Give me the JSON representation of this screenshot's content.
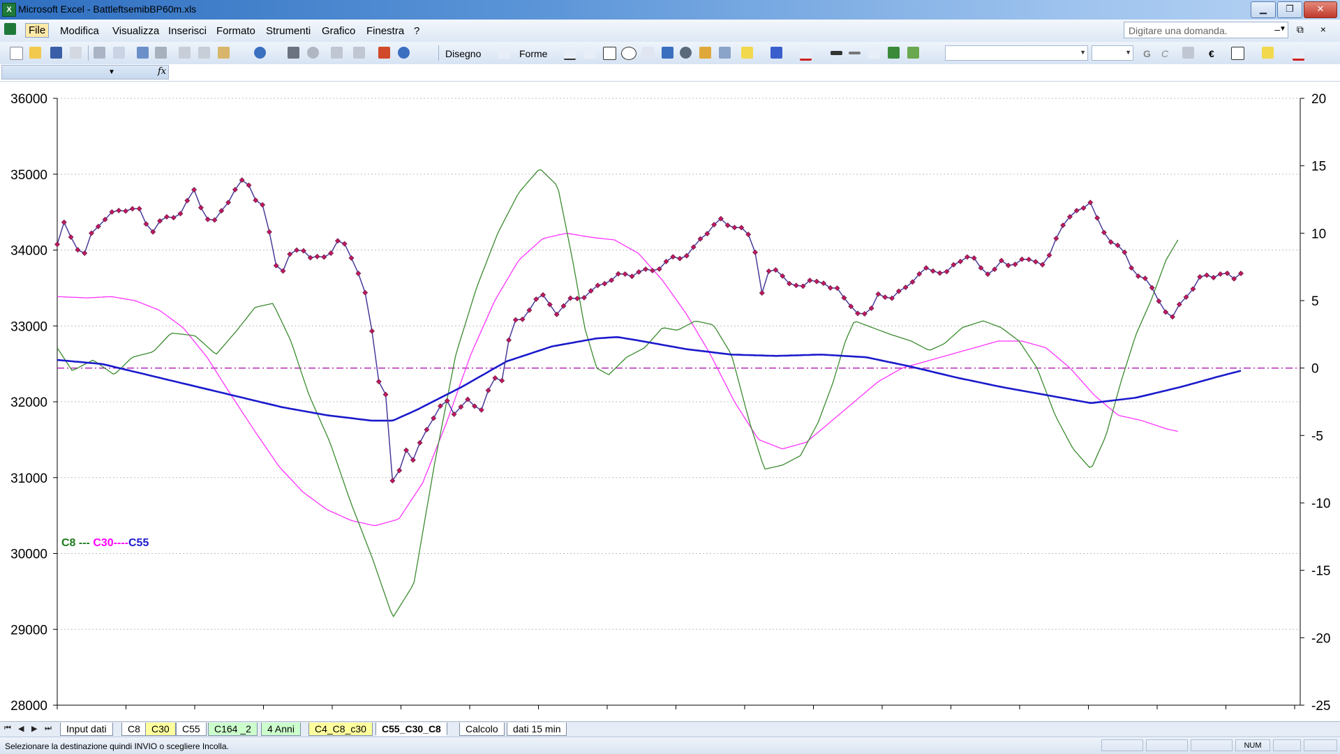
{
  "window": {
    "title": "Microsoft Excel - BattleftsemibBP60m.xls",
    "minimize": "▁",
    "restore": "❐",
    "close": "✕"
  },
  "menu": {
    "items": [
      "File",
      "Modifica",
      "Visualizza",
      "Inserisci",
      "Formato",
      "Strumenti",
      "Grafico",
      "Finestra",
      "?"
    ],
    "ask_placeholder": "Digitare una domanda.",
    "mdi": "–  ⧉  ×"
  },
  "toolbar": {
    "drawing_label": "Disegno",
    "shapes_label": "Forme",
    "bold": "G",
    "italic": "C",
    "euro": "€"
  },
  "formula": {
    "fx": "fx"
  },
  "chart_data": {
    "type": "line",
    "legend_text": {
      "c8": "C8 ---",
      "c30": " C30----",
      "c55": "C55"
    },
    "colors": {
      "price": "#4a3a9a",
      "price_marker": "#c2185b",
      "c8": "#3a8a2e",
      "c30": "#ff33ff",
      "c55": "#1a1acc",
      "zero": "#b01ab0",
      "legend_c8": "#1a7a1a",
      "legend_c30": "#ff00ff",
      "legend_c55": "#1a1acc"
    },
    "left_axis": {
      "min": 28000,
      "max": 36000,
      "ticks": [
        "28000",
        "29000",
        "30000",
        "31000",
        "32000",
        "33000",
        "34000",
        "35000",
        "36000"
      ]
    },
    "right_axis": {
      "min": -25,
      "max": 20,
      "ticks": [
        "-25",
        "-20",
        "-15",
        "-10",
        "-5",
        "0",
        "5",
        "10",
        "15",
        "20"
      ]
    },
    "n_points": 174,
    "zero_line": 0,
    "price": {
      "anchors": [
        [
          0,
          34050
        ],
        [
          1,
          34380
        ],
        [
          3,
          34280
        ],
        [
          6,
          34100
        ],
        [
          9,
          33950
        ],
        [
          12,
          34260
        ],
        [
          16,
          34400
        ],
        [
          20,
          34500
        ],
        [
          24,
          34600
        ],
        [
          28,
          34500
        ],
        [
          31,
          34200
        ],
        [
          34,
          34350
        ],
        [
          38,
          34450
        ],
        [
          42,
          34550
        ],
        [
          46,
          34780
        ],
        [
          49,
          34450
        ],
        [
          52,
          34330
        ],
        [
          56,
          34630
        ],
        [
          59,
          34780
        ],
        [
          63,
          34920
        ],
        [
          66,
          34680
        ],
        [
          69,
          34560
        ],
        [
          71,
          34200
        ],
        [
          73,
          33850
        ],
        [
          75,
          33720
        ],
        [
          78,
          33920
        ],
        [
          82,
          34020
        ],
        [
          85,
          33880
        ],
        [
          88,
          33920
        ],
        [
          91,
          33980
        ],
        [
          94,
          34100
        ],
        [
          97,
          33990
        ],
        [
          100,
          33780
        ],
        [
          102,
          33520
        ],
        [
          104,
          33280
        ],
        [
          105,
          32950
        ],
        [
          107,
          32350
        ],
        [
          108,
          32200
        ],
        [
          110,
          32050
        ],
        [
          111,
          30820
        ],
        [
          113,
          31000
        ],
        [
          115,
          31150
        ],
        [
          117,
          31500
        ],
        [
          119,
          31200
        ],
        [
          121,
          31450
        ],
        [
          124,
          31720
        ],
        [
          127,
          31850
        ],
        [
          130,
          31990
        ],
        [
          133,
          31850
        ],
        [
          136,
          32050
        ],
        [
          139,
          31950
        ],
        [
          142,
          31900
        ],
        [
          145,
          32250
        ],
        [
          148,
          32300
        ],
        [
          150,
          32330
        ],
        [
          151,
          33100
        ],
        [
          155,
          33050
        ],
        [
          158,
          33250
        ],
        [
          161,
          33400
        ],
        [
          164,
          33300
        ],
        [
          167,
          33200
        ],
        [
          170,
          33320
        ],
        [
          173,
          33350
        ],
        [
          176,
          33380
        ],
        [
          179,
          33450
        ],
        [
          182,
          33600
        ],
        [
          185,
          33640
        ],
        [
          188,
          33660
        ],
        [
          191,
          33650
        ],
        [
          194,
          33700
        ],
        [
          197,
          33730
        ],
        [
          200,
          33790
        ],
        [
          203,
          33830
        ],
        [
          206,
          33870
        ],
        [
          209,
          33900
        ],
        [
          212,
          34000
        ],
        [
          215,
          34180
        ],
        [
          218,
          34320
        ],
        [
          221,
          34370
        ],
        [
          224,
          34300
        ],
        [
          227,
          34330
        ],
        [
          230,
          34250
        ],
        [
          233,
          34000
        ],
        [
          234,
          33750
        ],
        [
          235,
          33420
        ],
        [
          236,
          33650
        ],
        [
          239,
          33700
        ],
        [
          242,
          33680
        ],
        [
          245,
          33550
        ],
        [
          248,
          33500
        ],
        [
          251,
          33640
        ],
        [
          254,
          33540
        ],
        [
          257,
          33480
        ],
        [
          260,
          33560
        ],
        [
          263,
          33340
        ],
        [
          266,
          33200
        ],
        [
          269,
          33180
        ],
        [
          271,
          33060
        ],
        [
          273,
          33390
        ],
        [
          276,
          33430
        ],
        [
          279,
          33380
        ],
        [
          282,
          33480
        ],
        [
          285,
          33580
        ],
        [
          288,
          33650
        ],
        [
          291,
          33770
        ],
        [
          294,
          33750
        ],
        [
          297,
          33700
        ],
        [
          300,
          33830
        ],
        [
          303,
          33900
        ],
        [
          306,
          33850
        ],
        [
          309,
          33760
        ],
        [
          312,
          33720
        ],
        [
          315,
          33830
        ],
        [
          318,
          33790
        ],
        [
          321,
          33830
        ],
        [
          324,
          33870
        ],
        [
          327,
          33910
        ],
        [
          330,
          33780
        ],
        [
          333,
          34100
        ],
        [
          336,
          34370
        ],
        [
          339,
          34450
        ],
        [
          342,
          34580
        ],
        [
          345,
          34680
        ],
        [
          347,
          34400
        ],
        [
          349,
          34200
        ],
        [
          352,
          34100
        ],
        [
          355,
          34050
        ],
        [
          358,
          33800
        ],
        [
          361,
          33700
        ],
        [
          364,
          33580
        ],
        [
          366,
          33380
        ],
        [
          368,
          33300
        ],
        [
          370,
          33200
        ],
        [
          372,
          33100
        ],
        [
          374,
          33250
        ],
        [
          376,
          33400
        ],
        [
          379,
          33500
        ],
        [
          382,
          33620
        ],
        [
          385,
          33650
        ],
        [
          388,
          33700
        ],
        [
          391,
          33680
        ],
        [
          393,
          33640
        ],
        [
          395,
          33720
        ]
      ],
      "domain": [
        0,
        395
      ]
    },
    "c8": [
      [
        0,
        1.5
      ],
      [
        5,
        -0.2
      ],
      [
        12,
        0.6
      ],
      [
        19,
        -0.5
      ],
      [
        25,
        0.8
      ],
      [
        32,
        1.2
      ],
      [
        38,
        2.6
      ],
      [
        46,
        2.4
      ],
      [
        53,
        1.0
      ],
      [
        60,
        2.8
      ],
      [
        66,
        4.5
      ],
      [
        72,
        4.8
      ],
      [
        78,
        2.0
      ],
      [
        84,
        -2.0
      ],
      [
        91,
        -5.5
      ],
      [
        98,
        -10
      ],
      [
        105,
        -14
      ],
      [
        112,
        -18.5
      ],
      [
        119,
        -16
      ],
      [
        126,
        -7
      ],
      [
        133,
        1
      ],
      [
        140,
        6
      ],
      [
        147,
        10
      ],
      [
        154,
        13
      ],
      [
        161,
        14.8
      ],
      [
        167,
        13.5
      ],
      [
        172,
        8
      ],
      [
        176,
        3
      ],
      [
        180,
        0
      ],
      [
        184,
        -0.5
      ],
      [
        190,
        0.8
      ],
      [
        196,
        1.5
      ],
      [
        202,
        3
      ],
      [
        207,
        2.8
      ],
      [
        213,
        3.5
      ],
      [
        219,
        3.2
      ],
      [
        225,
        1
      ],
      [
        231,
        -4
      ],
      [
        236,
        -7.5
      ],
      [
        242,
        -7.2
      ],
      [
        248,
        -6.5
      ],
      [
        254,
        -4
      ],
      [
        259,
        -1
      ],
      [
        263,
        2
      ],
      [
        266,
        3.5
      ],
      [
        272,
        3
      ],
      [
        278,
        2.5
      ],
      [
        285,
        2
      ],
      [
        291,
        1.3
      ],
      [
        296,
        1.8
      ],
      [
        302,
        3
      ],
      [
        309,
        3.5
      ],
      [
        315,
        3
      ],
      [
        321,
        2
      ],
      [
        327,
        0
      ],
      [
        333,
        -3.5
      ],
      [
        339,
        -6
      ],
      [
        345,
        -7.5
      ],
      [
        350,
        -5
      ],
      [
        355,
        -1
      ],
      [
        360,
        2.5
      ],
      [
        365,
        5
      ],
      [
        370,
        8
      ],
      [
        374,
        9.5
      ]
    ],
    "c30": [
      [
        0,
        5.3
      ],
      [
        10,
        5.2
      ],
      [
        18,
        5.3
      ],
      [
        26,
        5.0
      ],
      [
        34,
        4.3
      ],
      [
        42,
        3.0
      ],
      [
        50,
        0.8
      ],
      [
        58,
        -2
      ],
      [
        66,
        -4.7
      ],
      [
        74,
        -7.3
      ],
      [
        82,
        -9.2
      ],
      [
        90,
        -10.5
      ],
      [
        98,
        -11.3
      ],
      [
        106,
        -11.7
      ],
      [
        114,
        -11.2
      ],
      [
        122,
        -8.5
      ],
      [
        130,
        -4
      ],
      [
        138,
        1
      ],
      [
        146,
        5
      ],
      [
        154,
        8
      ],
      [
        162,
        9.6
      ],
      [
        170,
        10
      ],
      [
        178,
        9.7
      ],
      [
        186,
        9.5
      ],
      [
        194,
        8.5
      ],
      [
        202,
        6.5
      ],
      [
        210,
        4
      ],
      [
        218,
        1
      ],
      [
        226,
        -2.5
      ],
      [
        234,
        -5.3
      ],
      [
        242,
        -6
      ],
      [
        250,
        -5.5
      ],
      [
        258,
        -4
      ],
      [
        266,
        -2.5
      ],
      [
        274,
        -1
      ],
      [
        282,
        0
      ],
      [
        290,
        0.5
      ],
      [
        298,
        1
      ],
      [
        306,
        1.5
      ],
      [
        314,
        2
      ],
      [
        322,
        2
      ],
      [
        330,
        1.5
      ],
      [
        338,
        0
      ],
      [
        346,
        -2
      ],
      [
        354,
        -3.5
      ],
      [
        362,
        -3.9
      ],
      [
        370,
        -4.5
      ],
      [
        374,
        -4.7
      ]
    ],
    "c55": [
      [
        0,
        0.6
      ],
      [
        15,
        0.3
      ],
      [
        30,
        -0.5
      ],
      [
        45,
        -1.3
      ],
      [
        60,
        -2.1
      ],
      [
        75,
        -2.9
      ],
      [
        90,
        -3.5
      ],
      [
        105,
        -3.9
      ],
      [
        112,
        -3.9
      ],
      [
        120,
        -3.1
      ],
      [
        135,
        -1.4
      ],
      [
        150,
        0.5
      ],
      [
        165,
        1.6
      ],
      [
        180,
        2.2
      ],
      [
        187,
        2.3
      ],
      [
        195,
        2.0
      ],
      [
        210,
        1.4
      ],
      [
        225,
        1.0
      ],
      [
        240,
        0.9
      ],
      [
        255,
        1.0
      ],
      [
        270,
        0.8
      ],
      [
        285,
        0.1
      ],
      [
        300,
        -0.7
      ],
      [
        315,
        -1.4
      ],
      [
        330,
        -2.0
      ],
      [
        345,
        -2.6
      ],
      [
        360,
        -2.2
      ],
      [
        375,
        -1.4
      ],
      [
        388,
        -0.6
      ],
      [
        395,
        -0.2
      ]
    ],
    "c_domain": [
      0,
      374
    ],
    "c55_domain": [
      0,
      395
    ]
  },
  "sheets": {
    "nav": [
      "⏮",
      "◀",
      "▶",
      "⏭"
    ],
    "tabs": [
      "Input dati",
      "C8",
      "C30",
      "C55",
      "C164 _2",
      "4 Anni",
      "C4_C8_c30",
      "C55_C30_C8",
      "Calcolo",
      "dati 15 min"
    ]
  },
  "status": {
    "message": "Selezionare la destinazione quindi INVIO o scegliere Incolla.",
    "num": "NUM"
  }
}
